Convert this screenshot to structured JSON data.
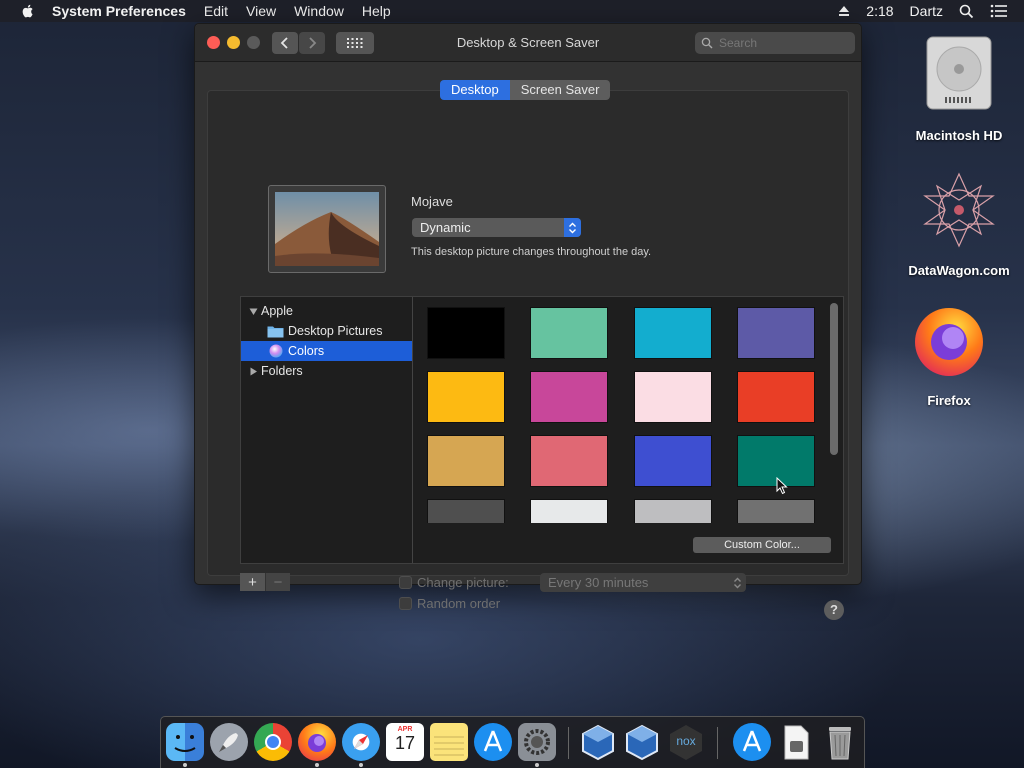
{
  "menubar": {
    "app_name": "System Preferences",
    "menus": [
      "Edit",
      "View",
      "Window",
      "Help"
    ],
    "clock": "2:18",
    "user": "Dartz"
  },
  "window": {
    "title": "Desktop & Screen Saver",
    "search_placeholder": "Search",
    "tabs": [
      {
        "label": "Desktop",
        "active": true
      },
      {
        "label": "Screen Saver",
        "active": false
      }
    ],
    "picture_name": "Mojave",
    "picture_mode": "Dynamic",
    "picture_description": "This desktop picture changes throughout the day.",
    "sidebar": {
      "group_apple": "Apple",
      "item_desktop_pictures": "Desktop Pictures",
      "item_colors": "Colors",
      "group_folders": "Folders"
    },
    "swatch_colors": [
      "#000000",
      "#66c3a0",
      "#13adcf",
      "#5d5aa7",
      "#fdba12",
      "#c8479a",
      "#fbdde4",
      "#e93e26",
      "#d6a652",
      "#e06874",
      "#3e4fd1",
      "#017a6a",
      "#4f4f4f",
      "#e7e9ea",
      "#bebec0",
      "#717171"
    ],
    "custom_color_button": "Custom Color...",
    "add_label": "+",
    "remove_label": "−",
    "change_picture_label": "Change picture:",
    "interval_value": "Every 30 minutes",
    "random_order_label": "Random order",
    "help_label": "?"
  },
  "desktop_icons": [
    {
      "label": "Macintosh HD"
    },
    {
      "label": "DataWagon.com"
    },
    {
      "label": "Firefox"
    }
  ],
  "dock": {
    "apps": [
      "finder",
      "launchpad",
      "chrome",
      "firefox",
      "safari",
      "calendar",
      "notes",
      "app-store",
      "system-preferences",
      "virtualbox",
      "virtualbox-2",
      "nox",
      "app-store-downloads",
      "documents",
      "trash"
    ],
    "calendar_month": "APR",
    "calendar_day": "17",
    "nox_label": "nox"
  }
}
